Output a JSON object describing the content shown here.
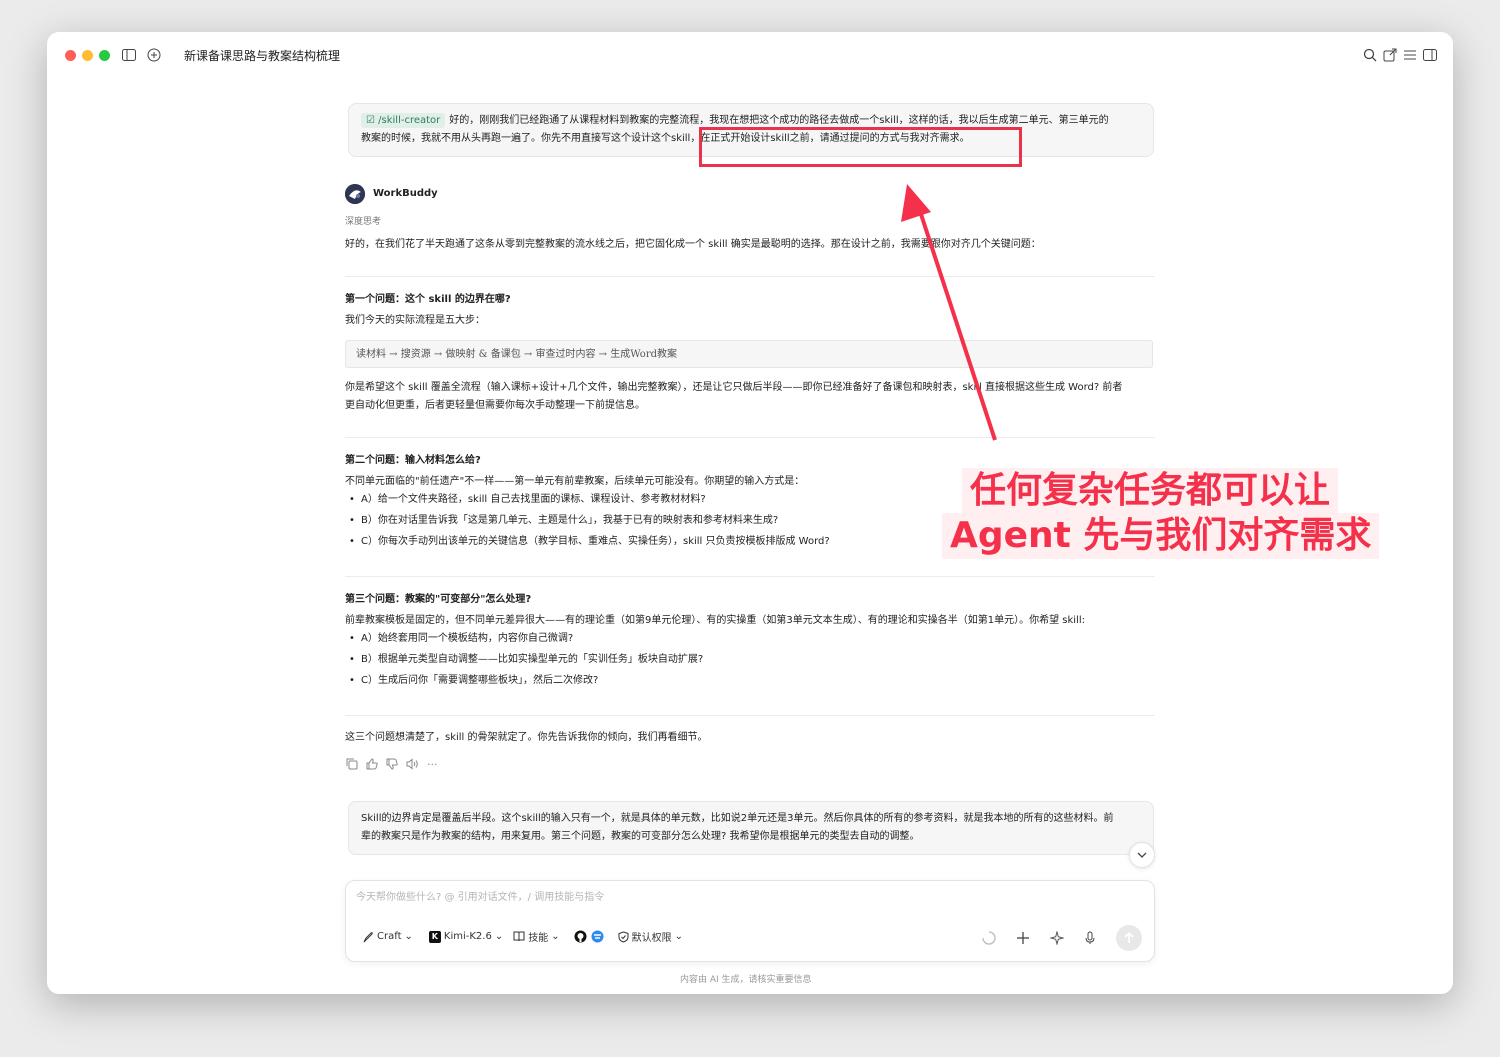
{
  "window": {
    "title": "新课备课思路与教案结构梳理"
  },
  "user_message_1": {
    "chip": "/skill-creator",
    "line1": "好的，刚刚我们已经跑通了从课程材料到教案的完整流程，我现在想把这个成功的路径去做成一个skill，这样的话，我以后生成第二单元、第三单元的",
    "line2": "教案的时候，我就不用从头再跑一遍了。你先不用直接写这个设计这个skill，在正式开始设计skill之前，请通过提问的方式与我对齐需求。"
  },
  "assistant": {
    "name": "WorkBuddy",
    "thinking_label": "深度思考",
    "intro": "好的，在我们花了半天跑通了这条从零到完整教案的流水线之后，把它固化成一个 skill 确实是最聪明的选择。那在设计之前，我需要跟你对齐几个关键问题：",
    "q1_title": "第一个问题：这个 skill 的边界在哪?",
    "q1_sub": "我们今天的实际流程是五大步：",
    "q1_flow": "读材料 → 搜资源 → 做映射 & 备课包 → 审查过时内容 → 生成Word教案",
    "q1_body1": "你是希望这个 skill 覆盖全流程（输入课标+设计+几个文件，输出完整教案），还是让它只做后半段——即你已经准备好了备课包和映射表，skill 直接根据这些生成 Word? 前者",
    "q1_body2": "更自动化但更重，后者更轻量但需要你每次手动整理一下前提信息。",
    "q2_title": "第二个问题：输入材料怎么给?",
    "q2_sub": "不同单元面临的\"前任遗产\"不一样——第一单元有前辈教案，后续单元可能没有。你期望的输入方式是：",
    "q2_items": [
      "A）给一个文件夹路径，skill 自己去找里面的课标、课程设计、参考教材材料?",
      "B）你在对话里告诉我「这是第几单元、主题是什么」，我基于已有的映射表和参考材料来生成?",
      "C）你每次手动列出该单元的关键信息（教学目标、重难点、实操任务），skill 只负责按模板排版成 Word?"
    ],
    "q3_title": "第三个问题：教案的\"可变部分\"怎么处理?",
    "q3_sub": "前辈教案模板是固定的，但不同单元差异很大——有的理论重（如第9单元伦理）、有的实操重（如第3单元文本生成）、有的理论和实操各半（如第1单元）。你希望 skill:",
    "q3_items": [
      "A）始终套用同一个模板结构，内容你自己微调?",
      "B）根据单元类型自动调整——比如实操型单元的「实训任务」板块自动扩展?",
      "C）生成后问你「需要调整哪些板块」，然后二次修改?"
    ],
    "closing": "这三个问题想清楚了，skill 的骨架就定了。你先告诉我你的倾向，我们再看细节。"
  },
  "user_message_2": {
    "line1": "Skill的边界肯定是覆盖后半段。这个skill的输入只有一个，就是具体的单元数，比如说2单元还是3单元。然后你具体的所有的参考资料，就是我本地的所有的这些材料。前",
    "line2": "辈的教案只是作为教案的结构，用来复用。第三个问题，教案的可变部分怎么处理? 我希望你是根据单元的类型去自动的调整。"
  },
  "input": {
    "placeholder": "今天帮你做些什么?  @ 引用对话文件，/ 调用技能与指令",
    "mode": "Craft",
    "model": "Kimi-K2.6",
    "skills": "技能",
    "permission": "默认权限"
  },
  "footer": "内容由 AI 生成，请核实重要信息",
  "annotation": {
    "line1": "任何复杂任务都可以让",
    "line2": "Agent 先与我们对齐需求"
  },
  "colors": {
    "accent_red": "#f5304a",
    "chip_green": "#2f7d5b"
  }
}
